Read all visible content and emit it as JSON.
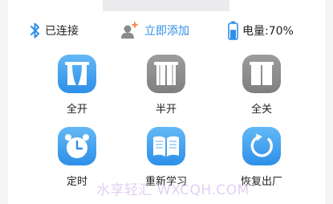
{
  "status": {
    "connection_text": "已连接",
    "add_text": "立即添加",
    "battery_text": "电量:70%",
    "battery_level": 70
  },
  "controls": [
    {
      "label": "全开",
      "icon": "curtain-open-icon",
      "color": "blue"
    },
    {
      "label": "半开",
      "icon": "curtain-half-icon",
      "color": "gray"
    },
    {
      "label": "全关",
      "icon": "curtain-closed-icon",
      "color": "gray"
    },
    {
      "label": "定时",
      "icon": "alarm-clock-icon",
      "color": "blue"
    },
    {
      "label": "重新学习",
      "icon": "open-book-icon",
      "color": "blue"
    },
    {
      "label": "恢复出厂",
      "icon": "refresh-icon",
      "color": "blue"
    }
  ],
  "watermark": "水享轻汇 WXCQH.COM",
  "colors": {
    "accent": "#2f8ee6",
    "inactive": "#8c8c8c",
    "background": "#ffffff"
  }
}
